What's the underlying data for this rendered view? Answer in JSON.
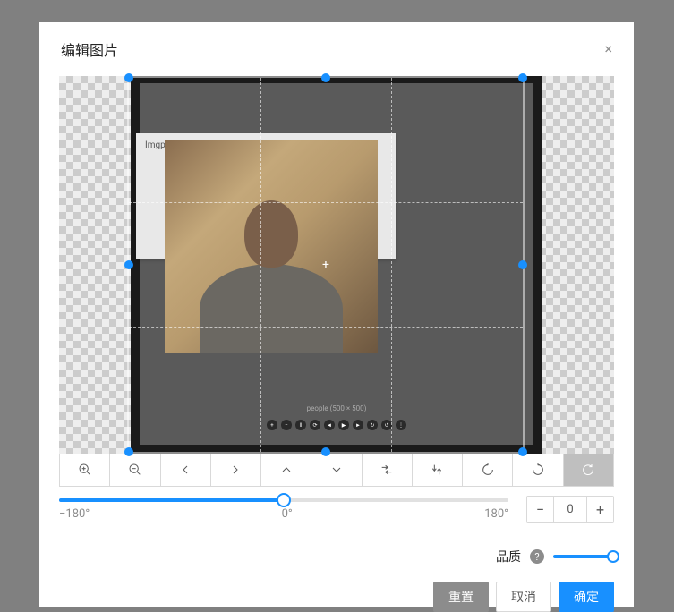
{
  "modal": {
    "title": "编辑图片",
    "close_label": "×"
  },
  "editor": {
    "panel_label": "Imgpo",
    "photo_caption": "people (500 × 500)",
    "media_icons": [
      "+",
      "−",
      "‖",
      "⟳",
      "◄",
      "▶",
      "►",
      "↻",
      "↺",
      "⋮"
    ]
  },
  "rotation": {
    "min_label": "−180°",
    "center_label": "0°",
    "max_label": "180°",
    "value": "0",
    "slider_percent": 50,
    "minus": "−",
    "plus": "+"
  },
  "quality": {
    "label": "品质",
    "help": "?"
  },
  "actions": {
    "reset": "重置",
    "cancel": "取消",
    "ok": "确定"
  }
}
